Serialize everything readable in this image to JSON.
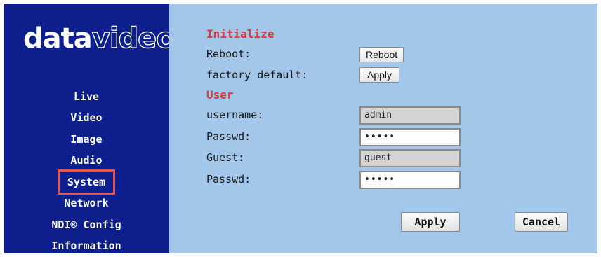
{
  "logo": {
    "bold": "data",
    "thin": "video"
  },
  "nav": {
    "live": "Live",
    "video": "Video",
    "image": "Image",
    "audio": "Audio",
    "system": "System",
    "network": "Network",
    "ndi_config": "NDI® Config",
    "information": "Information"
  },
  "initialize": {
    "heading": "Initialize",
    "reboot_label": "Reboot:",
    "reboot_button": "Reboot",
    "factory_label": "factory default:",
    "factory_button": "Apply"
  },
  "user": {
    "heading": "User",
    "username_label": "username:",
    "username_value": "admin",
    "passwd_label": "Passwd:",
    "passwd_value": "•••••",
    "guest_label": "Guest:",
    "guest_value": "guest",
    "guest_passwd_label": "Passwd:",
    "guest_passwd_value": "•••••"
  },
  "footer": {
    "apply": "Apply",
    "cancel": "Cancel"
  },
  "colors": {
    "sidebar": "#0c1f8c",
    "content": "#a3c7ea",
    "heading": "#d53b3b",
    "highlight": "#e8554a"
  }
}
